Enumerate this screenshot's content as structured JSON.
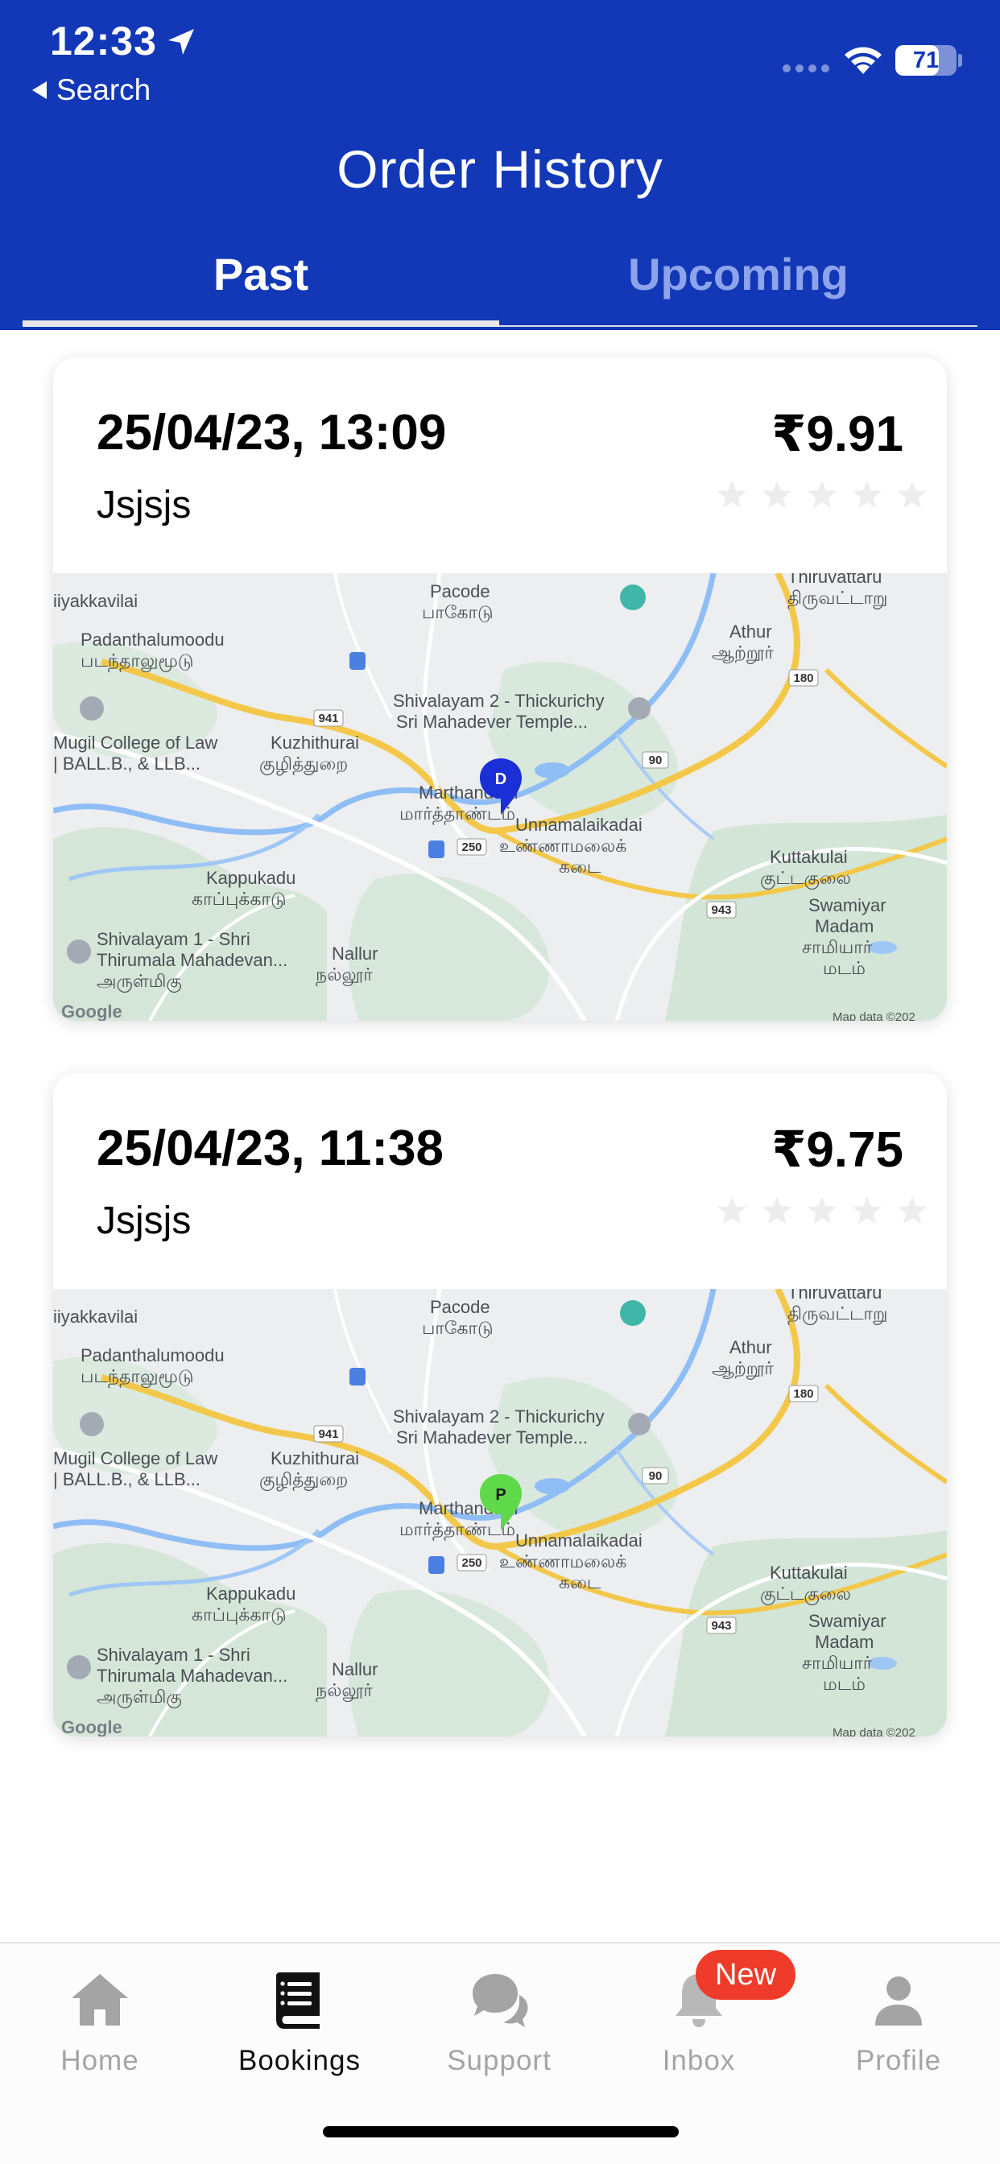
{
  "status_bar": {
    "time": "12:33",
    "back_label": "Search",
    "battery": "71",
    "battery_level": 0.71
  },
  "header": {
    "title": "Order History",
    "tabs": [
      {
        "label": "Past",
        "active": true
      },
      {
        "label": "Upcoming",
        "active": false
      }
    ],
    "color": "#1238b8"
  },
  "orders": [
    {
      "datetime": "25/04/23, 13:09",
      "price": "₹9.91",
      "name": "Jsjsjs",
      "rating": 0,
      "marker_label": "D",
      "marker_color": "#1a2fd6"
    },
    {
      "datetime": "25/04/23, 11:38",
      "price": "₹9.75",
      "name": "Jsjsjs",
      "rating": 0,
      "marker_label": "P",
      "marker_color": "#5fd84a"
    }
  ],
  "map_labels": {
    "pacode": "Pacode",
    "pacode_ta": "பாகோடு",
    "thiruvattaru": "Thiruvattaru",
    "thiruvattaru_ta": "திருவட்டாறு",
    "athur": "Athur",
    "athur_ta": "ஆற்றூர்",
    "iyakkavilai": "iiyakkavilai",
    "padanthalumoodu": "Padanthalumoodu",
    "padanthalumoodu_ta": "படந்தாலுமூடு",
    "shivalayam2": "Shivalayam 2 - Thickurichy",
    "shivalayam2_sub": "Sri Mahadever Temple...",
    "mugil1": "Mugil College of Law",
    "mugil2": "| BALL.B., & LLB...",
    "kuzhithurai": "Kuzhithurai",
    "kuzhithurai_ta": "குழித்துறை",
    "marthandam": "Marthandam",
    "marthandam_ta": "மார்த்தாண்டம்",
    "unnamalaikadai": "Unnamalaikadai",
    "unnamalaikadai_ta": "உண்ணாமலைக்",
    "unnamalaikadai_ta2": "கடை",
    "kuttakulai": "Kuttakulai",
    "kuttakulai_ta": "குட்டகுலை",
    "kappukadu": "Kappukadu",
    "kappukadu_ta": "காப்புக்காடு",
    "swamiyar1": "Swamiyar",
    "swamiyar2": "Madam",
    "swamiyar_ta1": "சாமியார்",
    "swamiyar_ta2": "மடம்",
    "shivalayam1": "Shivalayam 1 - Shri",
    "shivalayam1_sub": "Thirumala Mahadevan...",
    "shivalayam1_ta": "அருள்மிகு",
    "nallur": "Nallur",
    "nallur_ta": "நல்லூர்",
    "road_941": "941",
    "road_250": "250",
    "road_90": "90",
    "road_180": "180",
    "road_943": "943",
    "google": "Google",
    "map_data": "Map data ©202"
  },
  "bottom_nav": [
    {
      "label": "Home",
      "icon": "home-icon",
      "active": false
    },
    {
      "label": "Bookings",
      "icon": "bookings-icon",
      "active": true
    },
    {
      "label": "Support",
      "icon": "support-icon",
      "active": false
    },
    {
      "label": "Inbox",
      "icon": "inbox-bell-icon",
      "active": false,
      "badge": "New"
    },
    {
      "label": "Profile",
      "icon": "profile-icon",
      "active": false
    }
  ]
}
